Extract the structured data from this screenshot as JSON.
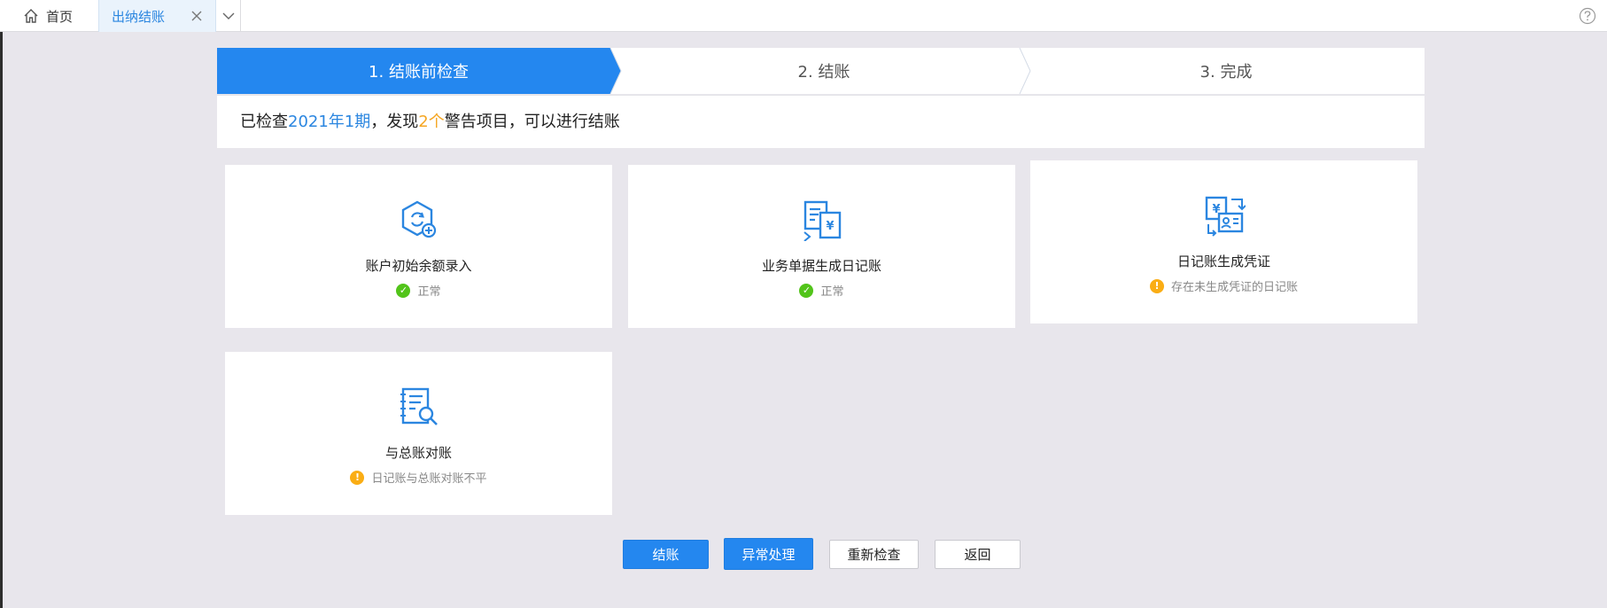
{
  "tabs": {
    "home_label": "首页",
    "active_label": "出纳结账"
  },
  "steps": [
    {
      "label": "1. 结账前检查"
    },
    {
      "label": "2. 结账"
    },
    {
      "label": "3. 完成"
    }
  ],
  "summary": {
    "prefix": "已检查",
    "period": "2021年1期",
    "mid": "，发现",
    "count": "2个",
    "suffix": "警告项目，可以进行结账"
  },
  "cards": [
    {
      "title": "账户初始余额录入",
      "status": "正常",
      "state": "ok",
      "icon": "account-balance-icon"
    },
    {
      "title": "业务单据生成日记账",
      "status": "正常",
      "state": "ok",
      "icon": "document-journal-icon"
    },
    {
      "title": "日记账生成凭证",
      "status": "存在未生成凭证的日记账",
      "state": "warn",
      "icon": "voucher-icon"
    },
    {
      "title": "与总账对账",
      "status": "日记账与总账对账不平",
      "state": "warn",
      "icon": "ledger-search-icon"
    }
  ],
  "buttons": {
    "close": "结账",
    "handle": "异常处理",
    "recheck": "重新检查",
    "back": "返回"
  },
  "colors": {
    "accent": "#2487ef",
    "ok": "#52c41a",
    "warn": "#faad14"
  }
}
